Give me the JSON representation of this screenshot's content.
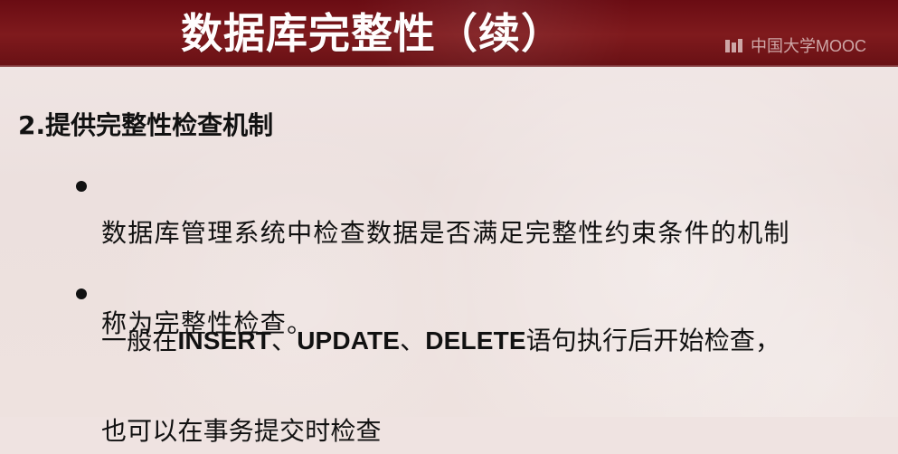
{
  "slide": {
    "title": "数据库完整性（续）",
    "watermark": "中国大学MOOC",
    "heading": "2.提供完整性检查机制",
    "bullets": [
      {
        "line1": "数据库管理系统中检查数据是否满足完整性约束条件的机制",
        "line2": "称为完整性检查。"
      },
      {
        "line1_prefix": "一般在",
        "keyword1": "INSERT",
        "separator1": "、",
        "keyword2": "UPDATE",
        "separator2": "、",
        "keyword3": "DELETE",
        "line1_suffix": "语句执行后开始检查，",
        "line2": "也可以在事务提交时检查"
      }
    ]
  },
  "colors": {
    "title_bar": "#7f1a1d",
    "background": "#efe3e1",
    "text": "#111111",
    "title_text": "#fffdfd"
  },
  "icons": {
    "watermark": "mooc-logo-icon",
    "bullet": "bullet-dot-icon"
  }
}
